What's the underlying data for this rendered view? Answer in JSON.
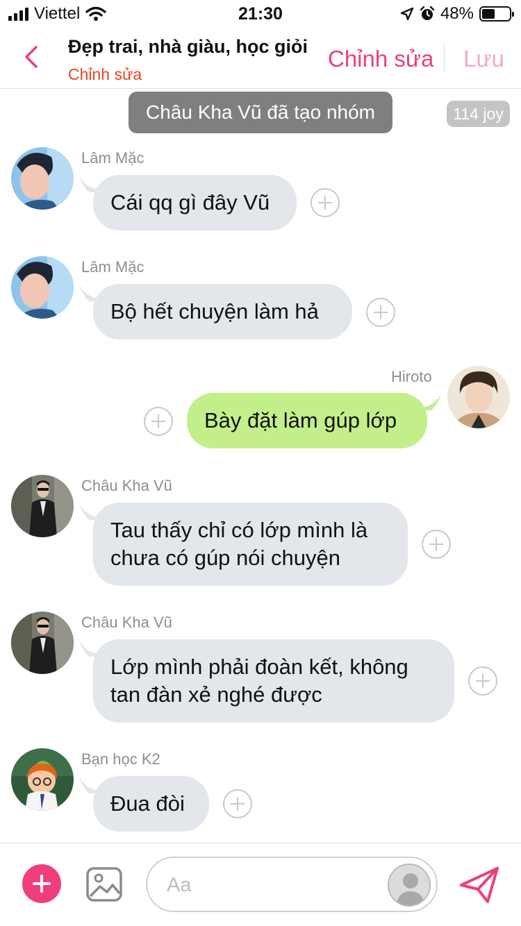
{
  "status_bar": {
    "carrier": "Viettel",
    "time": "21:30",
    "battery": "48%",
    "battery_level": 0.48,
    "icons": [
      "signal-bars-icon",
      "wifi-icon",
      "location-arrow-icon",
      "alarm-icon",
      "battery-icon"
    ]
  },
  "header": {
    "back_icon": "chevron-left-icon",
    "title": "Đẹp trai, nhà giàu, học giỏi",
    "subtitle": "Chỉnh sửa",
    "edit_label": "Chỉnh sửa",
    "save_label": "Lưu"
  },
  "chat": {
    "system_message": "Châu Kha Vũ đã tạo nhóm",
    "joy_badge": "114 joy",
    "messages": [
      {
        "sender": "Lâm Mặc",
        "direction": "in",
        "text": "Cái qq gì đây Vũ"
      },
      {
        "sender": "Lâm Mặc",
        "direction": "in",
        "text": "Bộ hết chuyện làm hả"
      },
      {
        "sender": "Hiroto",
        "direction": "out",
        "text": "Bày đặt làm gúp lớp"
      },
      {
        "sender": "Châu Kha Vũ",
        "direction": "in",
        "text": "Tau thấy chỉ có lớp mình là chưa có gúp nói chuyện"
      },
      {
        "sender": "Châu Kha Vũ",
        "direction": "in",
        "text": "Lớp mình phải đoàn kết, không tan đàn xẻ nghé được"
      },
      {
        "sender": "Bạn học K2",
        "direction": "in",
        "text": "Đua đòi"
      }
    ]
  },
  "composer": {
    "add_icon": "plus-icon",
    "gallery_icon": "image-icon",
    "placeholder": "Aa",
    "send_icon": "paper-plane-icon"
  },
  "colors": {
    "accent": "#ee3e7d",
    "accent_light": "#f6a7c4",
    "subtitle_red": "#e8431f",
    "incoming_bubble": "#e3e6ea",
    "outgoing_bubble": "#c3ef8b",
    "system_pill": "#7f7f7f"
  }
}
